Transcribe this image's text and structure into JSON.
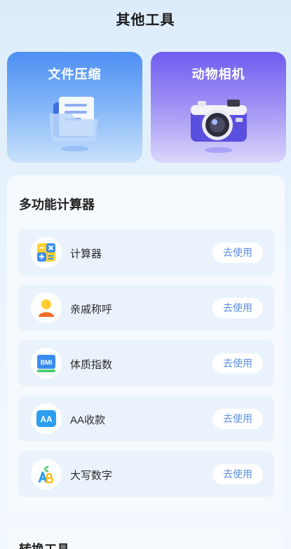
{
  "header": {
    "title": "其他工具"
  },
  "top_cards": [
    {
      "label": "文件压缩",
      "icon": "folder-documents-icon"
    },
    {
      "label": "动物相机",
      "icon": "camera-icon"
    }
  ],
  "calculator_section": {
    "title": "多功能计算器",
    "items": [
      {
        "label": "计算器",
        "icon": "calculator-icon",
        "button": "去使用"
      },
      {
        "label": "亲戚称呼",
        "icon": "person-icon",
        "button": "去使用"
      },
      {
        "label": "体质指数",
        "icon": "bmi-icon",
        "icon_text": "BMI",
        "button": "去使用"
      },
      {
        "label": "AA收款",
        "icon": "aa-icon",
        "icon_text": "AA",
        "button": "去使用"
      },
      {
        "label": "大写数字",
        "icon": "letters-icon",
        "button": "去使用"
      }
    ]
  },
  "convert_section": {
    "title": "转换工具"
  },
  "colors": {
    "accent": "#5a8fe0",
    "file_card": "#4d8ff3",
    "camera_card": "#6f5cf0"
  }
}
